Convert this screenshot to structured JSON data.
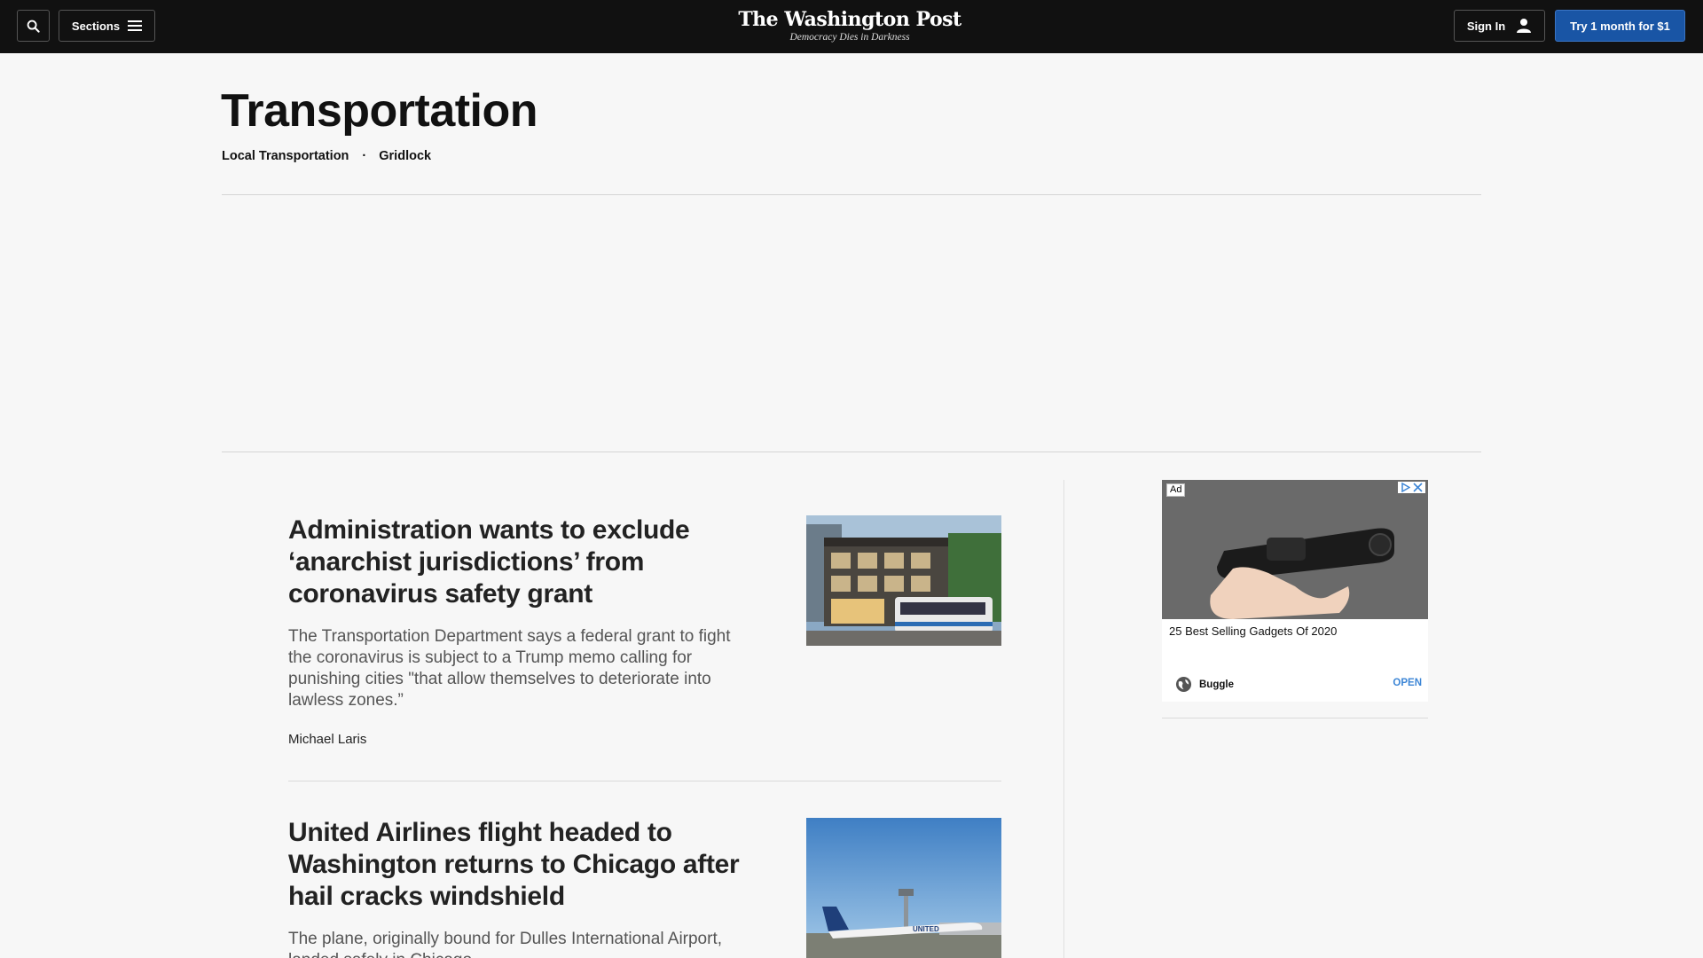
{
  "header": {
    "sections_label": "Sections",
    "logo_name": "The Washington Post",
    "logo_tagline": "Democracy Dies in Darkness",
    "signin_label": "Sign In",
    "subscribe_label": "Try 1 month for $1",
    "accent_color": "#1955a5"
  },
  "section": {
    "title": "Transportation",
    "subnav": [
      "Local Transportation",
      "Gridlock"
    ],
    "separator": "·"
  },
  "articles": [
    {
      "headline": "Administration wants to exclude ‘anarchist jurisdictions’ from coronavirus safety grant",
      "blurb": "The Transportation Department says a federal grant to fight the coronavirus is subject to a Trump memo calling for punishing cities \"that allow themselves to deteriorate into lawless zones.”",
      "byline": "Michael Laris",
      "image": "light-rail-train-street-photo"
    },
    {
      "headline": "United Airlines flight headed to Washington returns to Chicago after hail cracks windshield",
      "blurb": "The plane, originally bound for Dulles International Airport, landed safely in Chicago.",
      "image": "united-airplane-airport-photo",
      "aircraft_text": "UNITED"
    }
  ],
  "ad": {
    "badge": "Ad",
    "title": "25 Best Selling Gadgets Of 2020",
    "source": "Buggle",
    "cta": "OPEN",
    "image": "gadget-product-photo"
  }
}
